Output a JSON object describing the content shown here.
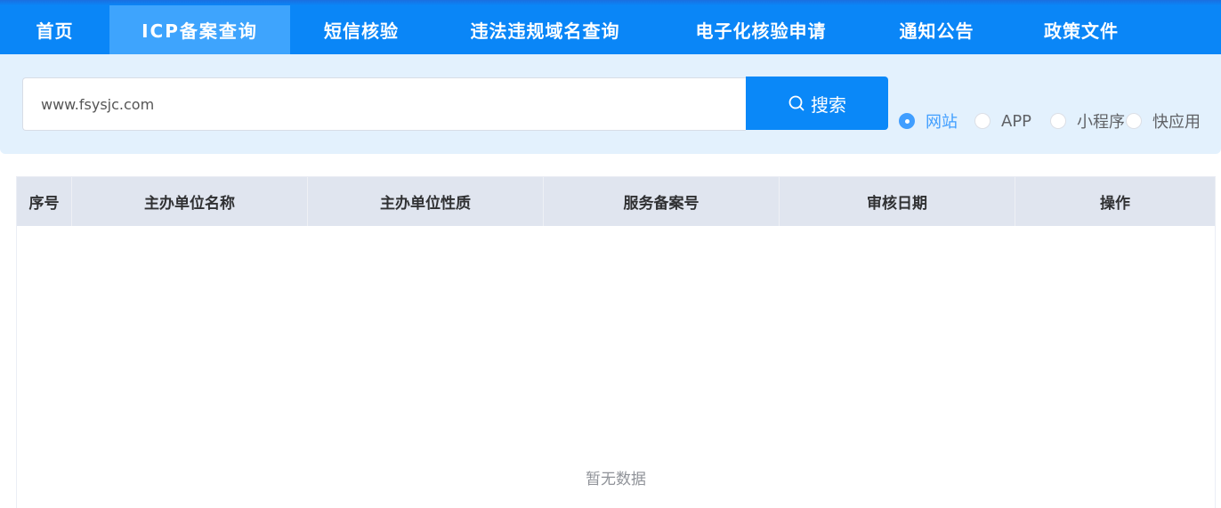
{
  "nav": {
    "items": [
      {
        "label": "首页"
      },
      {
        "label": "ICP备案查询",
        "active": true
      },
      {
        "label": "短信核验"
      },
      {
        "label": "违法违规域名查询"
      },
      {
        "label": "电子化核验申请"
      },
      {
        "label": "通知公告"
      },
      {
        "label": "政策文件"
      }
    ]
  },
  "search": {
    "value": "www.fsysjc.com",
    "button_label": "搜索",
    "button_icon": "search-icon",
    "types": [
      {
        "label": "网站",
        "checked": true
      },
      {
        "label": "APP",
        "checked": false
      },
      {
        "label": "小程序",
        "checked": false
      },
      {
        "label": "快应用",
        "checked": false
      }
    ]
  },
  "table": {
    "columns": [
      "序号",
      "主办单位名称",
      "主办单位性质",
      "服务备案号",
      "审核日期",
      "操作"
    ],
    "rows": [],
    "empty_text": "暂无数据"
  },
  "colors": {
    "nav_bg": "#0a86f7",
    "nav_active": "#3ea4fd",
    "panel_bg": "#e3f1fd",
    "button_bg": "#0a88f8",
    "radio_checked": "#409eff",
    "table_header_bg": "#e0e5ef"
  }
}
